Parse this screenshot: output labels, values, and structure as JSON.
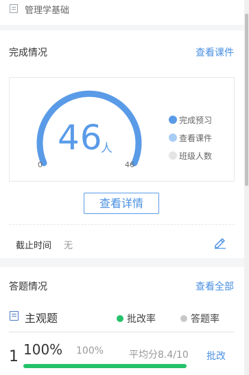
{
  "course": {
    "name": "管理学基础",
    "icon": "document-icon"
  },
  "completion": {
    "title": "完成情况",
    "link": "查看课件",
    "gauge": {
      "value": 46,
      "unit": "人",
      "min": "0",
      "max": "46",
      "fraction": 1.0
    },
    "legend": [
      {
        "label": "完成预习",
        "color": "#5a9be8"
      },
      {
        "label": "查看课件",
        "color": "#a8cdf5"
      },
      {
        "label": "班级人数",
        "color": "#e4e4e4"
      }
    ],
    "detail_button": "查看详情",
    "deadline_label": "截止时间",
    "deadline_value": "无",
    "edit_icon": "pencil-icon"
  },
  "answers": {
    "title": "答题情况",
    "link": "查看全部",
    "section": "主观题",
    "legend": [
      {
        "label": "批改率",
        "color": "#25c26b"
      },
      {
        "label": "答题率",
        "color": "#c8c8c8"
      }
    ],
    "item": {
      "number": "1",
      "correct_rate": "100%",
      "answer_rate": "100%",
      "average": "平均分8.4/10",
      "action": "批改",
      "progress": 1.0
    }
  },
  "colors": {
    "accent": "#4a90e2",
    "gauge": "#5a9be8",
    "green": "#25c26b"
  }
}
